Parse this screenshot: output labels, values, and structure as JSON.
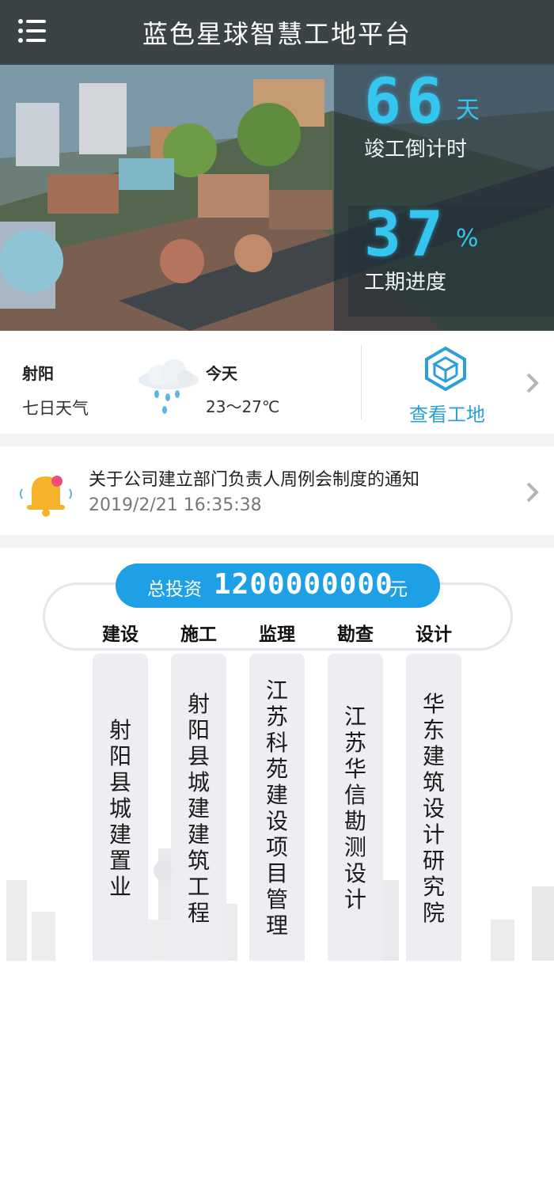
{
  "header": {
    "title": "蓝色星球智慧工地平台"
  },
  "stats": {
    "countdown": {
      "value": "66",
      "unit": "天",
      "label": "竣工倒计时"
    },
    "progress": {
      "value": "37",
      "unit": "%",
      "label": "工期进度"
    }
  },
  "weather": {
    "city": "射阳",
    "seven_day": "七日天气",
    "today": "今天",
    "temp": "23～27℃",
    "icon": "rain-cloud-icon"
  },
  "site_link": {
    "label": "查看工地",
    "icon": "cube-icon"
  },
  "notice": {
    "title": "关于公司建立部门负责人周例会制度的通知",
    "time": "2019/2/21 16:35:38",
    "icon": "bell-icon"
  },
  "investment": {
    "label": "总投资",
    "amount": "1200000000",
    "unit": "元"
  },
  "roles": [
    {
      "head": "建设",
      "company": "射阳县城建置业"
    },
    {
      "head": "施工",
      "company": "射阳县城建建筑工程"
    },
    {
      "head": "监理",
      "company": "江苏科苑建设项目管理"
    },
    {
      "head": "勘查",
      "company": "江苏华信勘测设计"
    },
    {
      "head": "设计",
      "company": "华东建筑设计研究院"
    }
  ],
  "colors": {
    "accent": "#1ea0e6",
    "digits": "#35c6f0",
    "link": "#2a9fd8"
  }
}
